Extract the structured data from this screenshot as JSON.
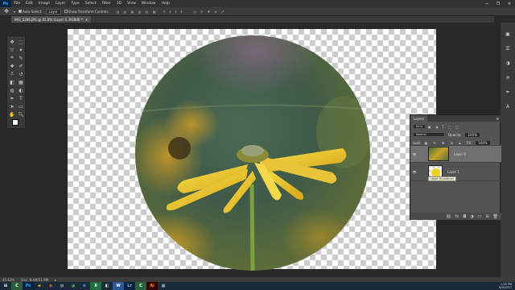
{
  "menubar": {
    "logo": "Ps",
    "items": [
      "File",
      "Edit",
      "Image",
      "Layer",
      "Type",
      "Select",
      "Filter",
      "3D",
      "View",
      "Window",
      "Help"
    ],
    "window_controls": [
      "—",
      "❐",
      "✕"
    ]
  },
  "options_bar": {
    "auto_select_label": "Auto-Select:",
    "auto_select_value": "Layer",
    "show_transform_label": "Show Transform Controls"
  },
  "document_tab": {
    "title": "IMG_5296.JPG @ 45.6% (Layer 0, RGB/8) *",
    "close": "✕"
  },
  "status_bar": {
    "zoom": "45.63%",
    "doc_size": "Doc: 8.4M/21.9M"
  },
  "layers_panel": {
    "tabs": [
      "Layers"
    ],
    "filter_label": "Kind",
    "blend_mode": "Normal",
    "opacity_label": "Opacity:",
    "opacity_value": "100%",
    "lock_label": "Lock:",
    "fill_label": "Fill:",
    "fill_value": "100%",
    "layers": [
      {
        "name": "Layer 0",
        "selected": true
      },
      {
        "name": "Layer 1",
        "selected": false
      }
    ],
    "tooltip": "Layer thumbnail"
  },
  "taskbar": {
    "clock_time": "2:28 PM",
    "clock_date": "6/4/2017"
  },
  "colors": {
    "accent": "#31a8ff",
    "panel_bg": "#535353",
    "selected_row": "#6f6f6f"
  }
}
